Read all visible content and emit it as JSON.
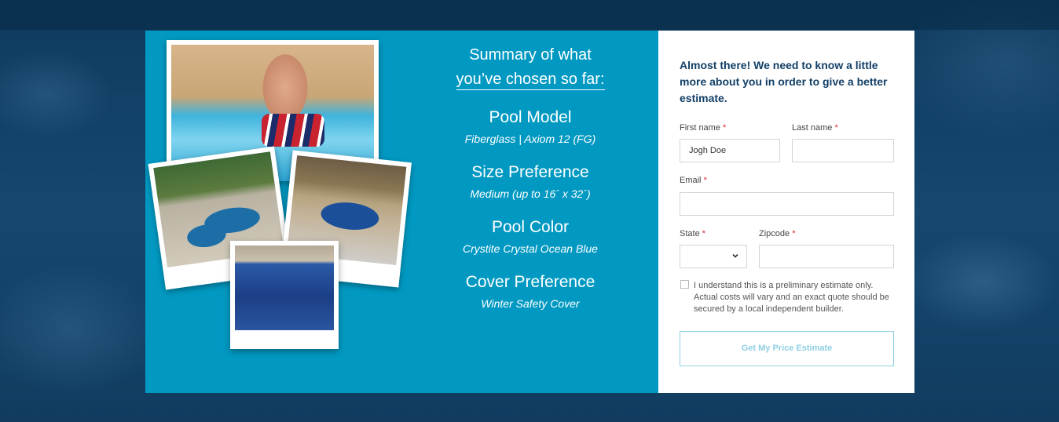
{
  "summary": {
    "title_line1": "Summary of what",
    "title_line2": "you’ve chosen so far:",
    "sections": [
      {
        "label": "Pool Model",
        "value": "Fiberglass | Axiom 12 (FG)"
      },
      {
        "label": "Size Preference",
        "value": "Medium (up to 16´ x 32´)"
      },
      {
        "label": "Pool Color",
        "value": "Crystite Crystal Ocean Blue"
      },
      {
        "label": "Cover Preference",
        "value": "Winter Safety Cover"
      }
    ]
  },
  "form": {
    "intro": "Almost there! We need to know a little more about you in order to give a better estimate.",
    "required_mark": "*",
    "first_name": {
      "label": "First name",
      "value": "Jogh Doe"
    },
    "last_name": {
      "label": "Last name",
      "value": ""
    },
    "email": {
      "label": "Email",
      "value": ""
    },
    "state": {
      "label": "State",
      "value": ""
    },
    "zipcode": {
      "label": "Zipcode",
      "value": ""
    },
    "consent_text": "I understand this is a preliminary estimate only. Actual costs will vary and an exact quote should be secured by a local independent builder.",
    "consent_checked": false,
    "submit_label": "Get My Price Estimate",
    "select_icon": "chevron-down-icon"
  },
  "colors": {
    "panel_blue": "#0199c2",
    "heading_navy": "#123f66",
    "required_red": "#e0262e",
    "button_outline": "#8fd0e2"
  }
}
